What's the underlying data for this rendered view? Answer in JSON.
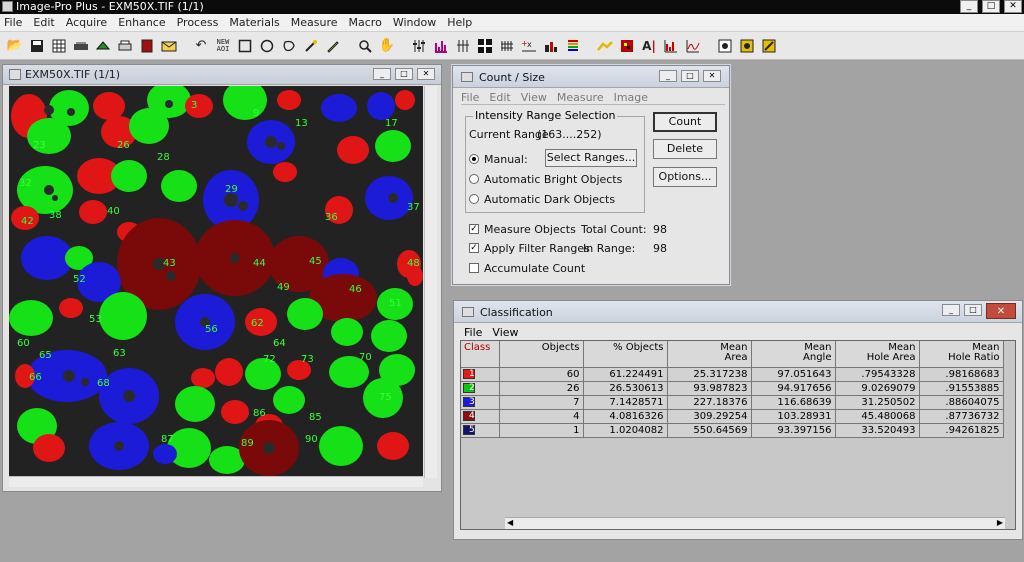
{
  "app": {
    "title": "Image-Pro Plus - EXM50X.TIF (1/1)",
    "window_buttons": [
      "_",
      "□",
      "✕"
    ]
  },
  "menubar": [
    "File",
    "Edit",
    "Acquire",
    "Enhance",
    "Process",
    "Materials",
    "Measure",
    "Macro",
    "Window",
    "Help"
  ],
  "toolbar": {
    "icons": [
      "open-icon",
      "save-icon",
      "grid-icon",
      "scanner-icon",
      "camera-icon",
      "print-icon",
      "book-icon",
      "mail-icon",
      "undo-icon",
      "new-aoi-icon",
      "rectangle-icon",
      "ellipse-icon",
      "irregular-icon",
      "magic-wand-icon",
      "pen-icon",
      "zoom-icon",
      "hand-icon",
      "sliders-icon",
      "histogram-icon",
      "count-icon",
      "grid-snap-icon",
      "cross-icon",
      "profile-icon",
      "color-icon",
      "bars-icon",
      "measure-icon",
      "palette-icon",
      "text-icon",
      "chart-icon",
      "wave-icon",
      "macro1-icon",
      "macro2-icon",
      "macro3-icon"
    ],
    "new_aoi_label": "NEW\nAOI"
  },
  "image_window": {
    "title": "EXM50X.TIF (1/1)"
  },
  "count_size": {
    "title": "Count / Size",
    "menu": [
      "File",
      "Edit",
      "View",
      "Measure",
      "Image"
    ],
    "group_title": "Intensity Range Selection",
    "current_range_label": "Current Range",
    "current_range_value": "(163....252)",
    "radio_manual": "Manual:",
    "radio_bright": "Automatic Bright Objects",
    "radio_dark": "Automatic Dark Objects",
    "select_ranges_button": "Select Ranges...",
    "count_button": "Count",
    "delete_button": "Delete",
    "options_button": "Options...",
    "measure_objects": "Measure Objects",
    "apply_filter": "Apply Filter Ranges",
    "accumulate": "Accumulate Count",
    "total_count_label": "Total Count:",
    "total_count_value": "98",
    "in_range_label": "In Range:",
    "in_range_value": "98"
  },
  "classification": {
    "title": "Classification",
    "menu": [
      "File",
      "View"
    ],
    "headers": [
      "Class",
      "Objects",
      "% Objects",
      "Mean\nArea",
      "Mean\nAngle",
      "Mean\nHole Area",
      "Mean\nHole Ratio"
    ],
    "rows": [
      {
        "class": "1",
        "color": "#e21a1a",
        "cells": [
          "60",
          "61.224491",
          "25.317238",
          "97.051643",
          ".79543328",
          ".98168683"
        ]
      },
      {
        "class": "2",
        "color": "#12c412",
        "cells": [
          "26",
          "26.530613",
          "93.987823",
          "94.917656",
          "9.0269079",
          ".91553885"
        ]
      },
      {
        "class": "3",
        "color": "#1c1cd6",
        "cells": [
          "7",
          "7.1428571",
          "227.18376",
          "116.68639",
          "31.250502",
          ".88604075"
        ]
      },
      {
        "class": "4",
        "color": "#8a1010",
        "cells": [
          "4",
          "4.0816326",
          "309.29254",
          "103.28931",
          "45.480068",
          ".87736732"
        ]
      },
      {
        "class": "5",
        "color": "#141468",
        "cells": [
          "1",
          "1.0204082",
          "550.64569",
          "93.397156",
          "33.520493",
          ".94261825"
        ]
      }
    ]
  },
  "overlay_numbers": [
    "3",
    "9",
    "13",
    "17",
    "23",
    "26",
    "28",
    "29",
    "32",
    "36",
    "37",
    "38",
    "40",
    "42",
    "43",
    "44",
    "45",
    "46",
    "48",
    "49",
    "51",
    "52",
    "53",
    "56",
    "60",
    "62",
    "63",
    "64",
    "65",
    "66",
    "68",
    "70",
    "72",
    "73",
    "75",
    "85",
    "86",
    "87",
    "89",
    "90"
  ]
}
